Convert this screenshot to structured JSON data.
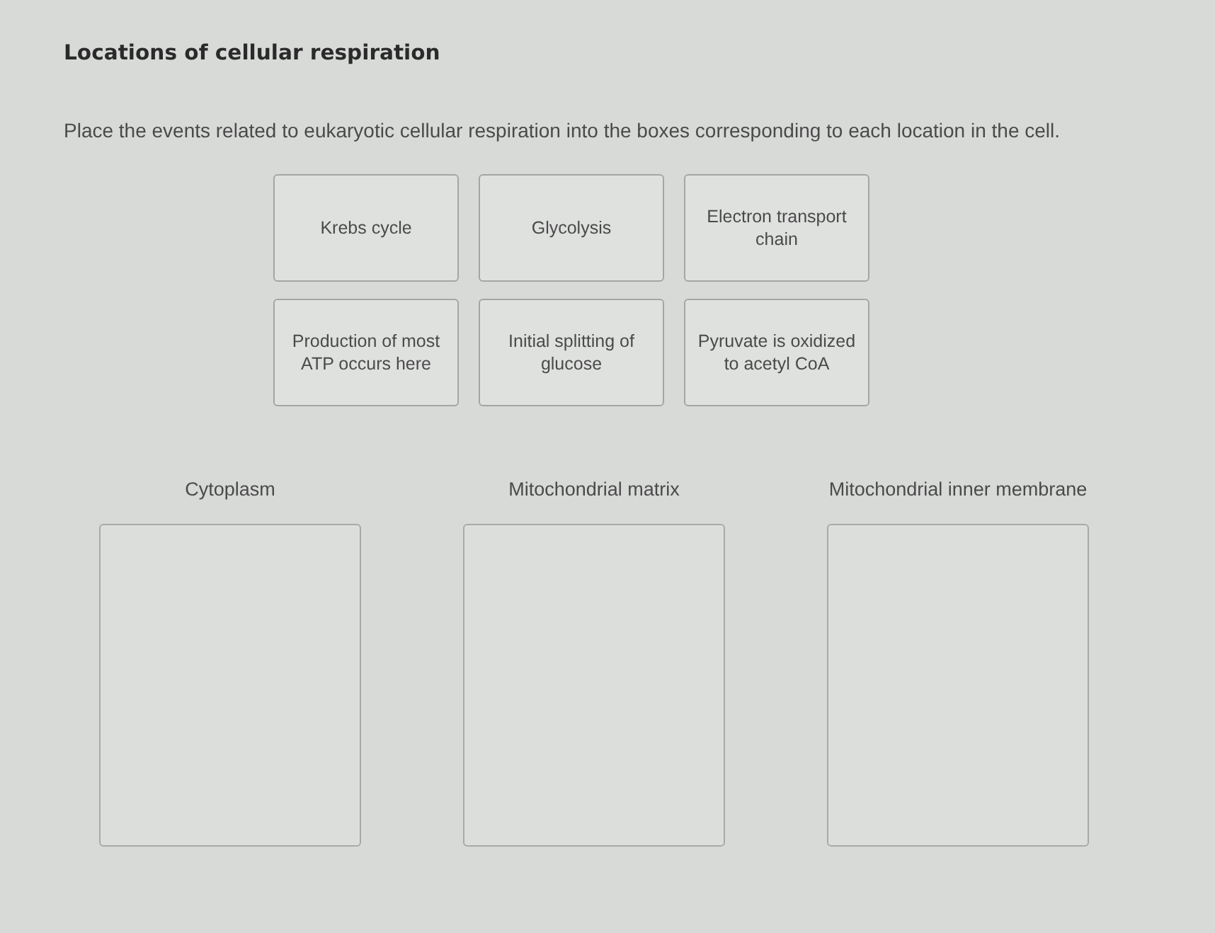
{
  "title": "Locations of cellular respiration",
  "instructions": "Place the events related to eukaryotic cellular respiration into the boxes corresponding to each location in the cell.",
  "items": [
    {
      "label": "Krebs cycle"
    },
    {
      "label": "Glycolysis"
    },
    {
      "label": "Electron transport chain"
    },
    {
      "label": "Production of most ATP occurs here"
    },
    {
      "label": "Initial splitting of glucose"
    },
    {
      "label": "Pyruvate is oxidized to acetyl CoA"
    }
  ],
  "zones": [
    {
      "label": "Cytoplasm"
    },
    {
      "label": "Mitochondrial matrix"
    },
    {
      "label": "Mitochondrial inner membrane"
    }
  ]
}
